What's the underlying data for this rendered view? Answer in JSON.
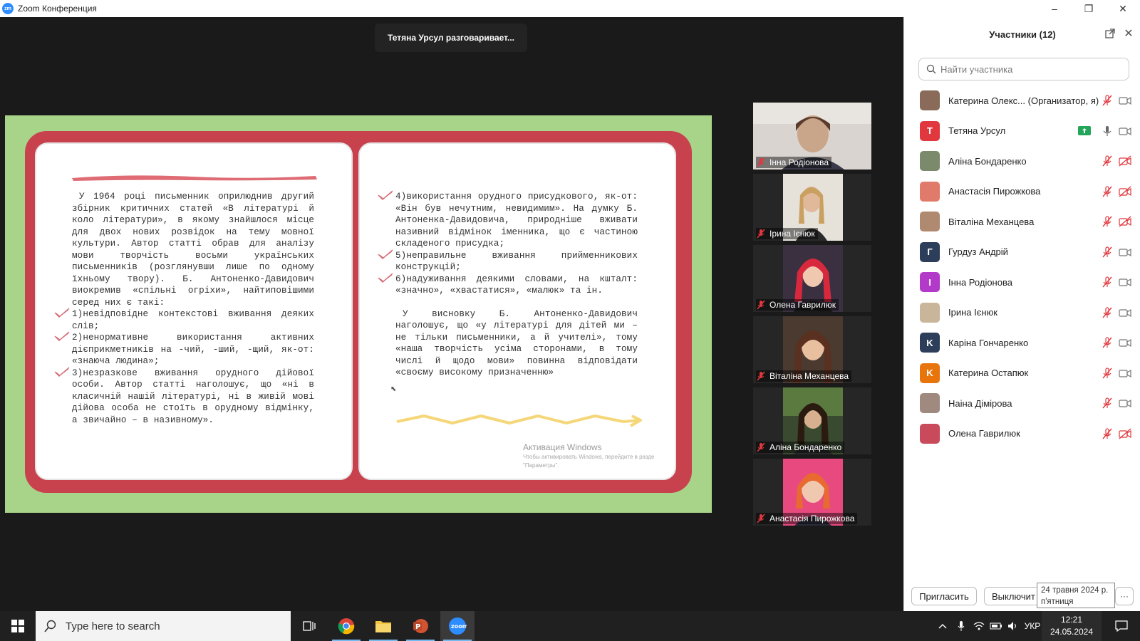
{
  "window": {
    "logo_text": "zm",
    "title": "Zoom Конференция",
    "minimize": "–",
    "restore": "❐",
    "close": "✕"
  },
  "banner": {
    "speaking": "Тетяна Урсул разговаривает..."
  },
  "slide": {
    "left_intro": "У 1964 році письменник оприлюднив другий збірник критичних статей «В літературі й коло літератури», в якому знайшлося місце для двох нових розвідок на тему мовної культури. Автор статті обрав для аналізу мови творчість восьми українських письменників (розглянувши лише по одному їхньому твору). Б. Антоненко-Давидович виокремив «спільні огріхи», найтиповішими серед них є такі:",
    "left_item1": "1)невідповідне контекстові вживання деяких слів;",
    "left_item2": "2)ненормативне використання активних дієприкметників на -чий, -ший, -щий, як-от: «знаюча людина»;",
    "left_item3": "3)незразкове вживання орудного дійової особи. Автор статті наголошує, що «ні в класичній нашій літературі, ні в живій мові дійова особа не стоїть в орудному відмінку, а звичайно – в називному».",
    "right_item4": "4)використання орудного присудкового, як-от: «Він був нечутним, невидимим». На думку Б. Антоненка-Давидовича, природніше вживати називний відмінок іменника, що є частиною складеного присудка;",
    "right_item5": "5)неправильне вживання прийменникових конструкцій;",
    "right_item6": "6)надуживання деякими словами, на кшталт: «значно», «хвастатися», «малюк» та ін.",
    "right_conclusion": "У висновку Б. Антоненко-Давидович наголошує, що «у літературі для дітей ми – не тільки письменники, а й учителі», тому «наша творчість усіма сторонами, в тому числі й щодо мови» повинна відповідати «своєму високому призначенню»",
    "watermark_title": "Активация Windows",
    "watermark_line1": "Чтобы активировать Windows, перейдите в разде",
    "watermark_line2": "\"Параметры\"."
  },
  "tiles": [
    {
      "name": "Інна Родіонова"
    },
    {
      "name": "Ірина Ієнюк"
    },
    {
      "name": "Олена Гаврилюк"
    },
    {
      "name": "Віталіна Механцева"
    },
    {
      "name": "Аліна Бондаренко"
    },
    {
      "name": "Анастасія Пирожкова"
    }
  ],
  "panel": {
    "title": "Участники (12)",
    "search_placeholder": "Найти участника",
    "participants": [
      {
        "name": "Катерина Олекс... (Организатор, я)",
        "initial": "",
        "color": "#8a6b5a",
        "mic": "muted",
        "cam": "on"
      },
      {
        "name": "Тетяна Урсул",
        "initial": "T",
        "color": "#e0383e",
        "mic": "on",
        "cam": "on",
        "sharing": true
      },
      {
        "name": "Аліна Бондаренко",
        "initial": "",
        "color": "#7a8a6a",
        "mic": "muted",
        "cam": "off"
      },
      {
        "name": "Анастасія Пирожкова",
        "initial": "",
        "color": "#e07a6a",
        "mic": "muted",
        "cam": "off"
      },
      {
        "name": "Віталіна Механцева",
        "initial": "",
        "color": "#b08a70",
        "mic": "muted",
        "cam": "off"
      },
      {
        "name": "Гурдуз Андрій",
        "initial": "Г",
        "color": "#2c3e5a",
        "mic": "muted",
        "cam": "on"
      },
      {
        "name": "Інна Родіонова",
        "initial": "I",
        "color": "#b33ac9",
        "mic": "muted",
        "cam": "on"
      },
      {
        "name": "Ірина Ієнюк",
        "initial": "",
        "color": "#c9b59a",
        "mic": "muted",
        "cam": "on"
      },
      {
        "name": "Каріна Гончаренко",
        "initial": "K",
        "color": "#2c3e5a",
        "mic": "muted",
        "cam": "on"
      },
      {
        "name": "Катерина Остапюк",
        "initial": "K",
        "color": "#e8740c",
        "mic": "muted",
        "cam": "on"
      },
      {
        "name": "Наіна Дімірова",
        "initial": "",
        "color": "#a08a80",
        "mic": "muted",
        "cam": "on"
      },
      {
        "name": "Олена Гаврилюк",
        "initial": "",
        "color": "#c94a5a",
        "mic": "muted",
        "cam": "off"
      }
    ],
    "invite": "Пригласить",
    "mute_all": "Выключит",
    "tooltip_date": "24 травня 2024 р.",
    "tooltip_day": "п'ятниця",
    "more": "···"
  },
  "taskbar": {
    "search_placeholder": "Type here to search",
    "language": "УКР",
    "time": "12:21",
    "date": "24.05.2024"
  },
  "colors": {
    "slide_bg": "#a8d48a",
    "book_red": "#c8424e",
    "zoom_blue": "#2d8cff",
    "muted_red": "#e0383e"
  }
}
